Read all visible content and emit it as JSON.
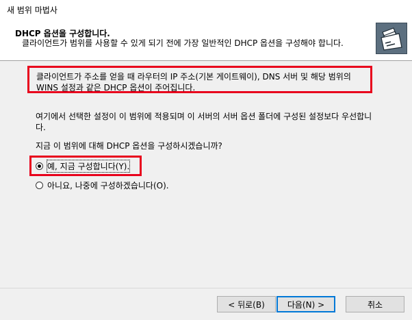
{
  "window": {
    "title": "새 범위 마법사"
  },
  "header": {
    "title": "DHCP 옵션을 구성합니다.",
    "description": "클라이언트가 범위를 사용할 수 있게 되기 전에 가장 일반적인 DHCP 옵션을 구성해야 합니다.",
    "icon": "folder-wizard-icon"
  },
  "body": {
    "info_text": "클라이언트가 주소를 얻을 때 라우터의 IP 주소(기본 게이트웨이), DNS 서버 및 해당 범위의 WINS 설정과 같은 DHCP 옵션이 주어집니다.",
    "precedence_text": "여기에서 선택한 설정이 이 범위에 적용되며 이 서버의 서버 옵션 폴더에 구성된 설정보다 우선합니다.",
    "question": "지금 이 범위에 대해 DHCP 옵션을 구성하시겠습니까?",
    "options": [
      {
        "label": "예, 지금 구성합니다(Y).",
        "checked": true
      },
      {
        "label": "아니요, 나중에 구성하겠습니다(O).",
        "checked": false
      }
    ]
  },
  "buttons": {
    "back": "< 뒤로(B)",
    "next": "다음(N) >",
    "cancel": "취소"
  },
  "colors": {
    "highlight": "#e8001c",
    "default_button_border": "#0078d7"
  }
}
